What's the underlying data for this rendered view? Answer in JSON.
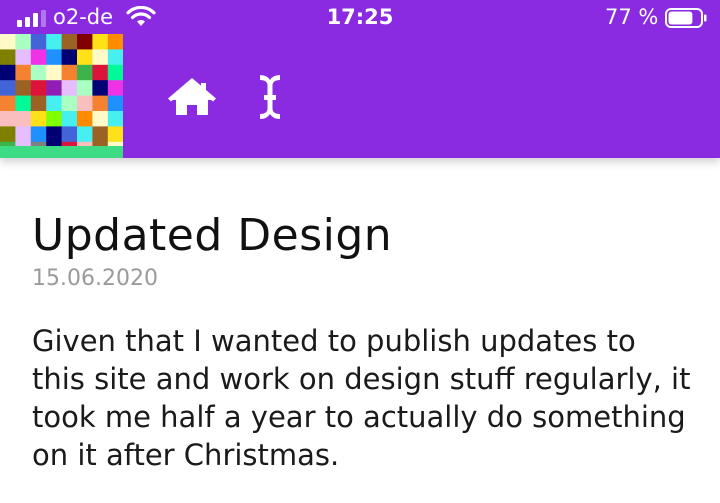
{
  "status_bar": {
    "carrier": "o2-de",
    "time": "17:25",
    "battery_percent": "77 %",
    "signal_bars": 3,
    "battery_level": 0.77
  },
  "header": {
    "background_color": "#8a2be2",
    "logo": "pixel-mosaic-logo",
    "nav": [
      {
        "icon": "home-icon"
      },
      {
        "icon": "text-cursor-icon"
      }
    ]
  },
  "post": {
    "title": "Updated Design",
    "date": "15.06.2020",
    "body": "Given that I wanted to publish updates to this site and work on design stuff regularly, it took me half a year to actually do something on it after Christmas."
  }
}
